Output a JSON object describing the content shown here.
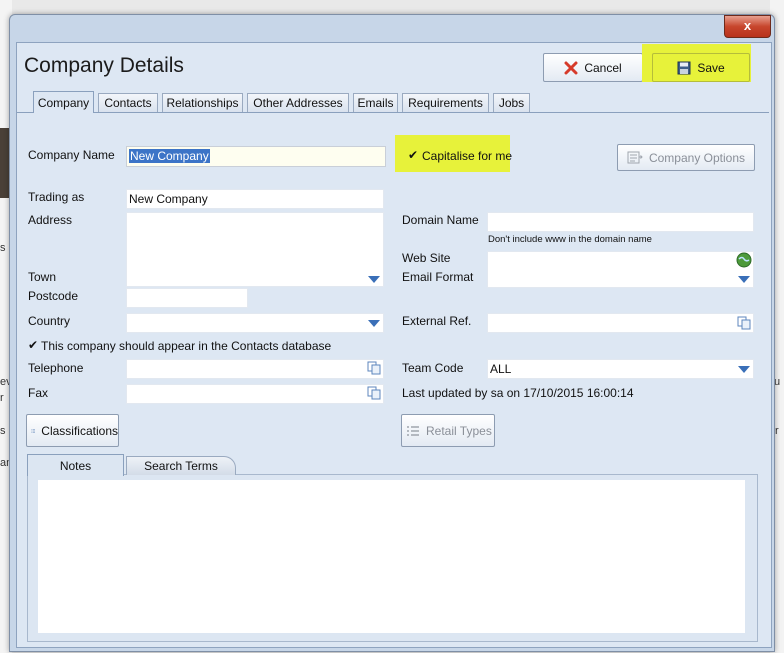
{
  "window": {
    "title": "Company Details",
    "close_glyph": "x"
  },
  "toolbar": {
    "cancel_label": "Cancel",
    "save_label": "Save"
  },
  "tabs": [
    {
      "label": "Company",
      "active": true
    },
    {
      "label": "Contacts",
      "active": false
    },
    {
      "label": "Relationships",
      "active": false
    },
    {
      "label": "Other Addresses",
      "active": false
    },
    {
      "label": "Emails",
      "active": false
    },
    {
      "label": "Requirements",
      "active": false
    },
    {
      "label": "Jobs",
      "active": false
    }
  ],
  "form": {
    "company_name_label": "Company Name",
    "company_name_value": "New Company",
    "capitalise_label": "Capitalise for me",
    "capitalise_checked": true,
    "company_options_label": "Company Options",
    "trading_as_label": "Trading as",
    "trading_as_value": "New Company",
    "address_label": "Address",
    "address_value": "",
    "town_label": "Town",
    "postcode_label": "Postcode",
    "country_label": "Country",
    "country_value": "",
    "contacts_db_label": "This company should appear in the Contacts database",
    "contacts_db_checked": true,
    "telephone_label": "Telephone",
    "telephone_value": "",
    "fax_label": "Fax",
    "fax_value": "",
    "domain_name_label": "Domain Name",
    "domain_name_value": "",
    "domain_hint": "Don't include www in the domain name",
    "web_site_label": "Web Site",
    "web_site_value": "",
    "email_format_label": "Email Format",
    "email_format_value": "",
    "external_ref_label": "External Ref.",
    "external_ref_value": "",
    "team_code_label": "Team Code",
    "team_code_value": "ALL",
    "last_updated": "Last updated by sa on 17/10/2015 16:00:14",
    "classifications_label": "Classifications",
    "retail_types_label": "Retail Types"
  },
  "notes_tabs": [
    {
      "label": "Notes",
      "active": true
    },
    {
      "label": "Search Terms",
      "active": false
    }
  ],
  "notes_value": "",
  "background_fragments": [
    "s",
    "ev",
    "r",
    "s a",
    "an",
    "u",
    "r"
  ],
  "colors": {
    "highlight": "#e7f23a",
    "selection": "#3c74c7",
    "accent_arrow": "#3a6fb8",
    "close_red": "#c7462d"
  }
}
